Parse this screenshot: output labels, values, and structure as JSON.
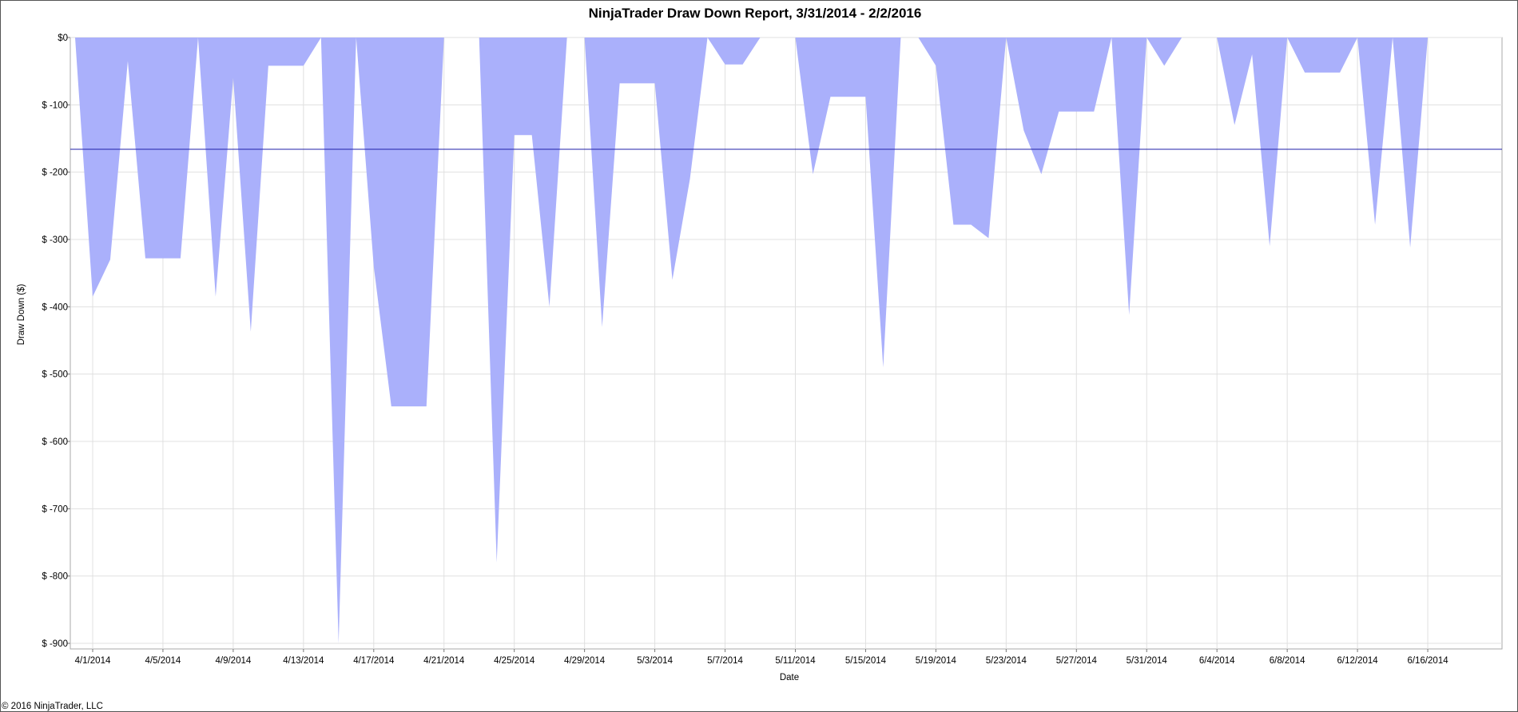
{
  "chart_data": {
    "type": "area",
    "title": "NinjaTrader Draw Down Report, 3/31/2014 - 2/2/2016",
    "xlabel": "Date",
    "ylabel": "Draw Down ($)",
    "ylim": [
      -900,
      0
    ],
    "y_ticks": [
      0,
      -100,
      -200,
      -300,
      -400,
      -500,
      -600,
      -700,
      -800,
      -900
    ],
    "y_tick_labels": [
      "$0",
      "$ -100",
      "$ -200",
      "$ -300",
      "$ -400",
      "$ -500",
      "$ -600",
      "$ -700",
      "$ -800",
      "$ -900"
    ],
    "x_tick_labels": [
      "4/1/2014",
      "4/5/2014",
      "4/9/2014",
      "4/13/2014",
      "4/17/2014",
      "4/21/2014",
      "4/25/2014",
      "4/29/2014",
      "5/3/2014",
      "5/7/2014",
      "5/11/2014",
      "5/15/2014",
      "5/19/2014",
      "5/23/2014",
      "5/27/2014",
      "5/31/2014",
      "6/4/2014",
      "6/8/2014",
      "6/12/2014",
      "6/16/2014"
    ],
    "x_tick_days": [
      1,
      5,
      9,
      13,
      17,
      21,
      25,
      29,
      33,
      37,
      41,
      45,
      49,
      53,
      57,
      61,
      65,
      69,
      73,
      77
    ],
    "x_range_days": [
      -0.0,
      81.0
    ],
    "grid": true,
    "average_drawdown": -166,
    "series": [
      {
        "values": [
          [
            0.0,
            0
          ],
          [
            1.0,
            -385
          ],
          [
            2.0,
            -330
          ],
          [
            3.0,
            -35
          ],
          [
            4.0,
            -328
          ],
          [
            5.0,
            -328
          ],
          [
            6.0,
            -328
          ],
          [
            7.0,
            0
          ],
          [
            8.0,
            -385
          ],
          [
            9.0,
            -60
          ],
          [
            10.0,
            -437
          ],
          [
            11.0,
            -42
          ],
          [
            12.0,
            -42
          ],
          [
            13.0,
            -42
          ],
          [
            14.0,
            0
          ],
          [
            15.0,
            -900
          ],
          [
            16.0,
            0
          ],
          [
            17.0,
            -340
          ],
          [
            18.0,
            -548
          ],
          [
            19.0,
            -548
          ],
          [
            20.0,
            -548
          ],
          [
            21.0,
            0
          ],
          [
            22.0,
            0
          ],
          [
            23.0,
            0
          ],
          [
            24.0,
            -780
          ],
          [
            25.0,
            -145
          ],
          [
            26.0,
            -145
          ],
          [
            27.0,
            -400
          ],
          [
            28.0,
            0
          ],
          [
            29.0,
            0
          ],
          [
            30.0,
            -430
          ],
          [
            31.0,
            -68
          ],
          [
            32.0,
            -68
          ],
          [
            33.0,
            -68
          ],
          [
            34.0,
            -360
          ],
          [
            35.0,
            -210
          ],
          [
            36.0,
            0
          ],
          [
            37.0,
            -40
          ],
          [
            38.0,
            -40
          ],
          [
            39.0,
            0
          ],
          [
            40.0,
            0
          ],
          [
            41.0,
            0
          ],
          [
            42.0,
            -203
          ],
          [
            43.0,
            -88
          ],
          [
            44.0,
            -88
          ],
          [
            45.0,
            -88
          ],
          [
            46.0,
            -490
          ],
          [
            47.0,
            0
          ],
          [
            48.0,
            0
          ],
          [
            49.0,
            -42
          ],
          [
            50.0,
            -278
          ],
          [
            51.0,
            -278
          ],
          [
            52.0,
            -298
          ],
          [
            53.0,
            0
          ],
          [
            54.0,
            -138
          ],
          [
            55.0,
            -203
          ],
          [
            56.0,
            -110
          ],
          [
            57.0,
            -110
          ],
          [
            58.0,
            -110
          ],
          [
            59.0,
            0
          ],
          [
            60.0,
            -412
          ],
          [
            61.0,
            0
          ],
          [
            62.0,
            -42
          ],
          [
            63.0,
            0
          ],
          [
            64.0,
            0
          ],
          [
            65.0,
            0
          ],
          [
            66.0,
            -130
          ],
          [
            67.0,
            -25
          ],
          [
            68.0,
            -310
          ],
          [
            69.0,
            0
          ],
          [
            70.0,
            -52
          ],
          [
            71.0,
            -52
          ],
          [
            72.0,
            -52
          ],
          [
            73.0,
            0
          ],
          [
            74.0,
            -278
          ],
          [
            75.0,
            0
          ],
          [
            76.0,
            -312
          ],
          [
            77.0,
            0
          ]
        ],
        "color": "#aab0fb"
      }
    ],
    "reference_line_color": "#1f1fa8",
    "copyright": "© 2016 NinjaTrader, LLC"
  }
}
